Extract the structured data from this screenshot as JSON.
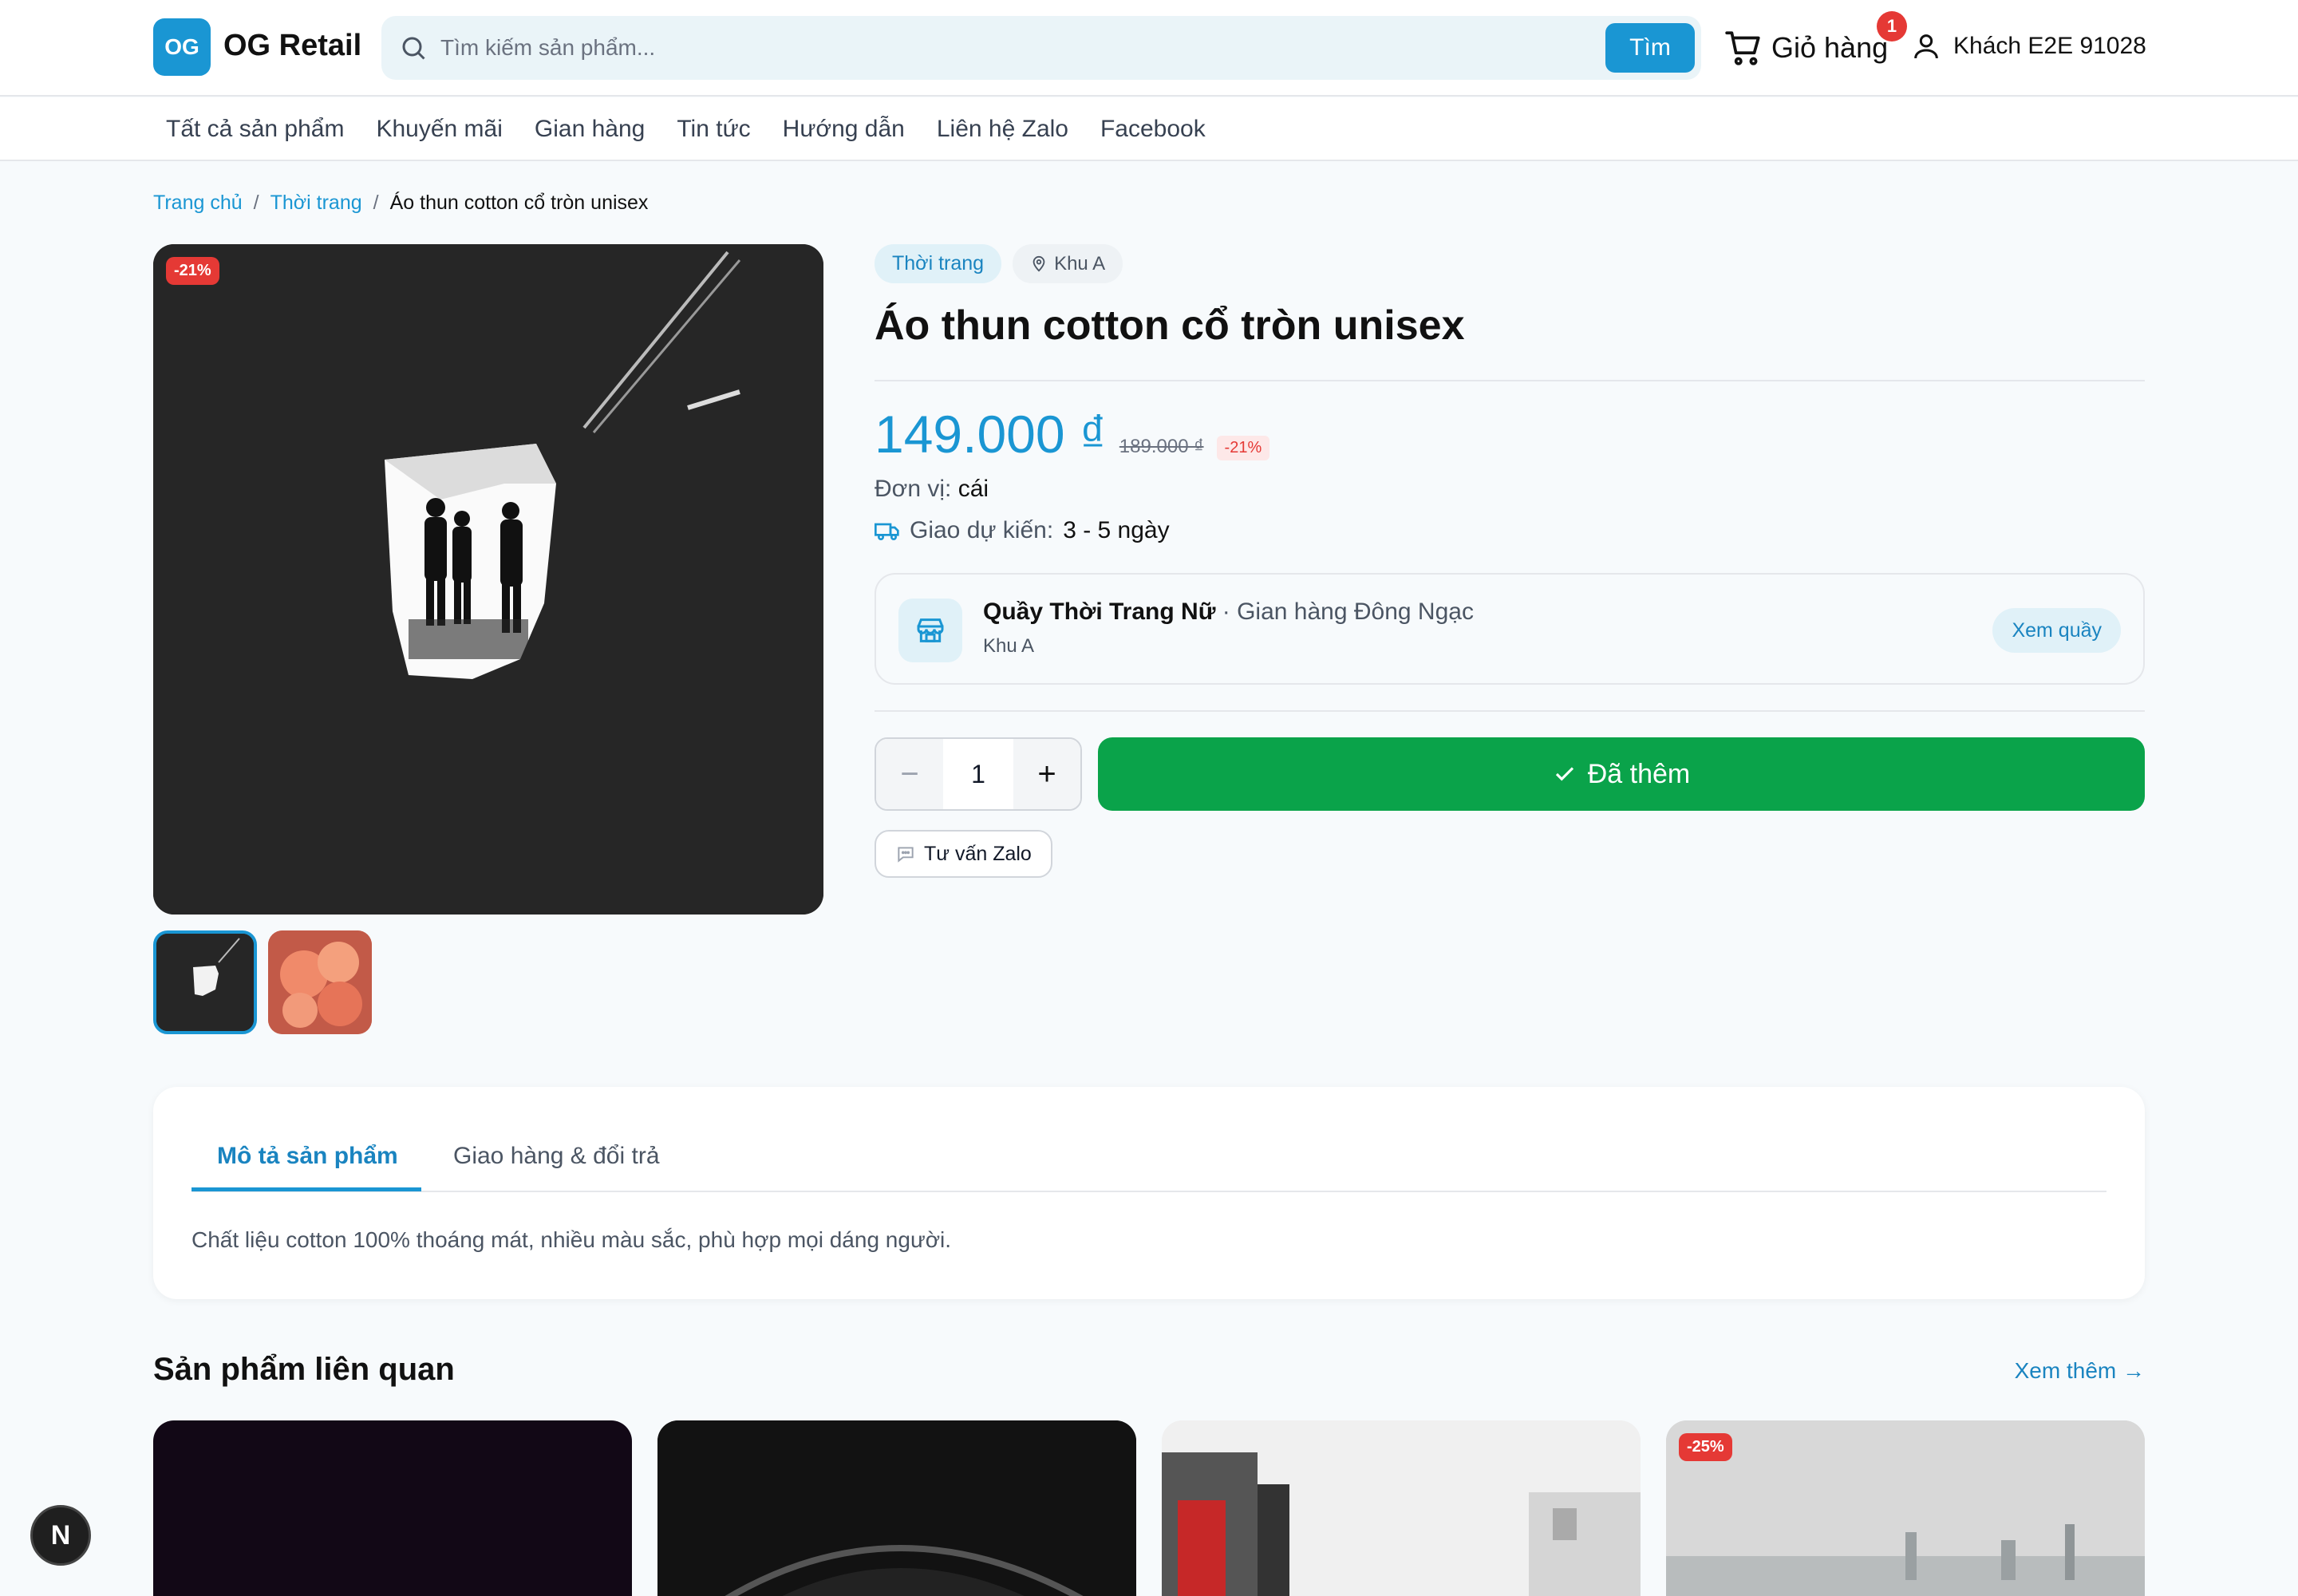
{
  "header": {
    "logo_mark": "OG",
    "logo_text": "OG Retail",
    "search_placeholder": "Tìm kiếm sản phẩm...",
    "search_button": "Tìm",
    "cart_label": "Giỏ hàng",
    "cart_count": "1",
    "user_label": "Khách E2E 91028"
  },
  "nav": {
    "items": [
      "Tất cả sản phẩm",
      "Khuyến mãi",
      "Gian hàng",
      "Tin tức",
      "Hướng dẫn",
      "Liên hệ Zalo",
      "Facebook"
    ]
  },
  "breadcrumb": {
    "home": "Trang chủ",
    "category": "Thời trang",
    "current": "Áo thun cotton cổ tròn unisex",
    "separator": "/"
  },
  "gallery": {
    "discount_badge": "-21%"
  },
  "product": {
    "category_tag": "Thời trang",
    "location_tag": "Khu A",
    "title": "Áo thun cotton cổ tròn unisex",
    "price": "149.000 ₫",
    "old_price": "189.000 ₫",
    "discount": "-21%",
    "unit_label": "Đơn vị:",
    "unit_value": "cái",
    "delivery_label": "Giao dự kiến:",
    "delivery_value": "3 - 5 ngày",
    "quantity": "1",
    "added_label": "Đã thêm",
    "zalo_label": "Tư vấn Zalo"
  },
  "shop": {
    "name": "Quầy Thời Trang Nữ",
    "sub": "· Gian hàng Đông Ngạc",
    "area": "Khu A",
    "button": "Xem quầy"
  },
  "tabs": {
    "active": "Mô tả sản phẩm",
    "inactive": "Giao hàng & đổi trả",
    "description": "Chất liệu cotton 100% thoáng mát, nhiều màu sắc, phù hợp mọi dáng người."
  },
  "related": {
    "title": "Sản phẩm liên quan",
    "see_more": "Xem thêm →",
    "card4_badge": "-25%"
  },
  "dev_badge": "N",
  "colors": {
    "accent": "#1a96d3",
    "success": "#0aa34a",
    "danger": "#e53935"
  }
}
